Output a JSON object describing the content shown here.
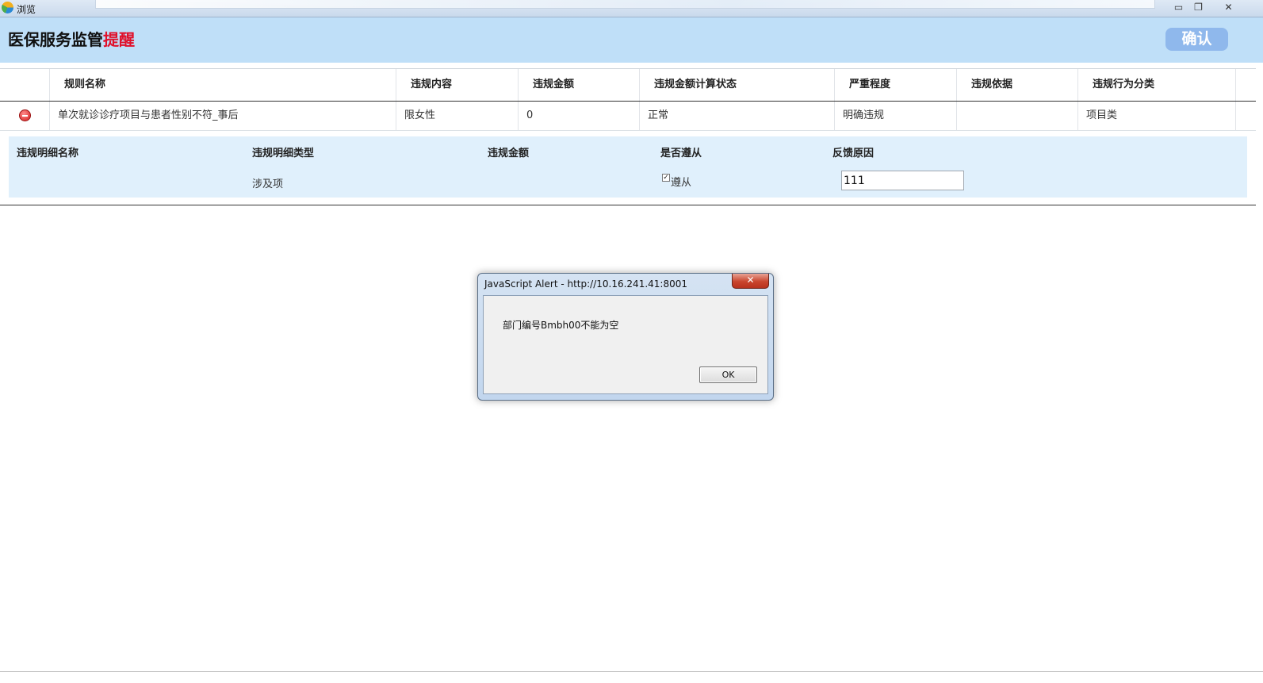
{
  "window": {
    "title": "浏览",
    "min_glyph": "▭",
    "restore_glyph": "❐",
    "close_glyph": "✕"
  },
  "header": {
    "title_main": "医保服务监管",
    "title_highlight": "提醒",
    "confirm_label": "确认"
  },
  "table": {
    "columns": [
      "规则名称",
      "违规内容",
      "违规金额",
      "违规金额计算状态",
      "严重程度",
      "违规依据",
      "违规行为分类"
    ],
    "row": {
      "rule_name": "单次就诊诊疗项目与患者性别不符_事后",
      "content": "限女性",
      "amount": "0",
      "calc_status": "正常",
      "severity": "明确违规",
      "basis": "",
      "category": "项目类"
    }
  },
  "detail": {
    "columns": [
      "违规明细名称",
      "违规明细类型",
      "违规金额",
      "是否遵从",
      "反馈原因"
    ],
    "row": {
      "name": "",
      "type": "涉及项",
      "amount": "",
      "comply_label": "遵从",
      "comply_checked": true,
      "reason_value": "111"
    }
  },
  "dialog": {
    "title": "JavaScript Alert - http://10.16.241.41:8001",
    "message": "部门编号Bmbh00不能为空",
    "ok_label": "OK",
    "close_glyph": "✕"
  },
  "colors": {
    "header_bg": "#bfdff8",
    "title_highlight": "#e0102a",
    "confirm_btn": "#8fb8ec",
    "detail_bg": "#e0f0fc"
  }
}
